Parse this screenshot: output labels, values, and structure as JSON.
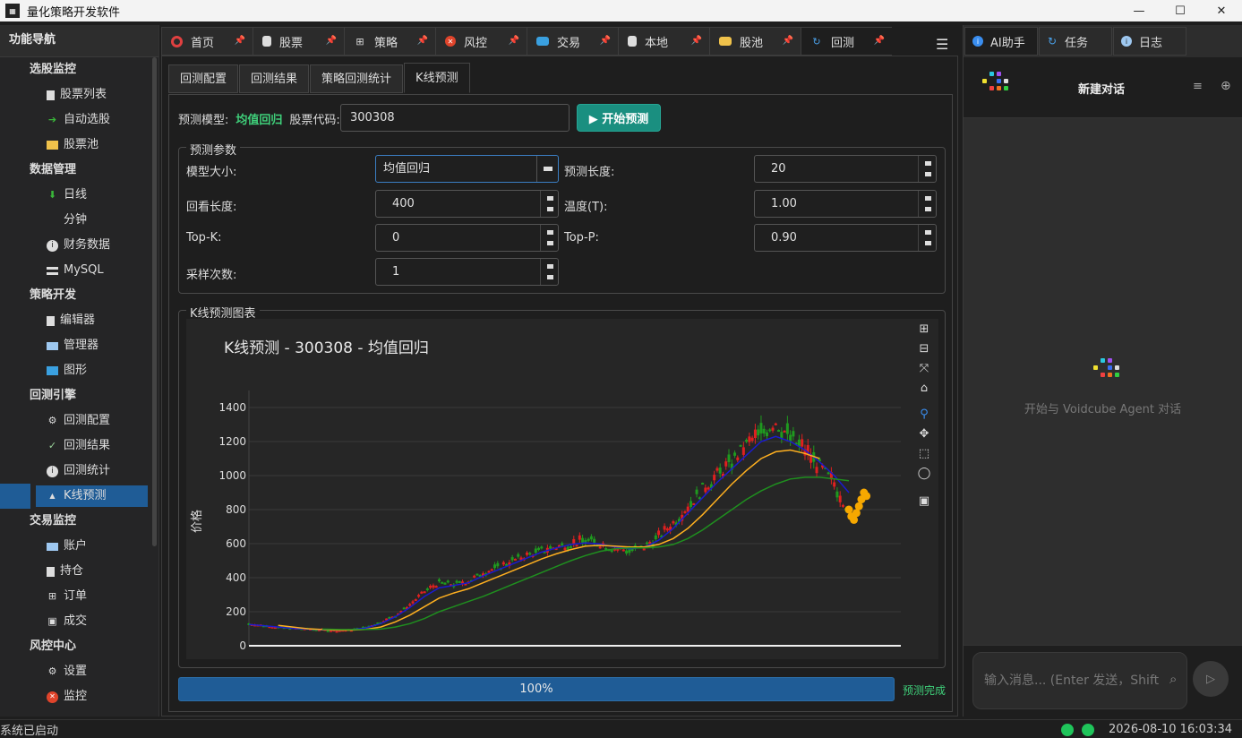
{
  "window": {
    "title": "量化策略开发软件",
    "minimize": "—",
    "maximize": "☐",
    "close": "✕"
  },
  "sidebar": {
    "header": "功能导航",
    "groups": [
      {
        "label": "选股监控",
        "items": [
          "股票列表",
          "自动选股",
          "股票池"
        ]
      },
      {
        "label": "数据管理",
        "items": [
          "日线",
          "分钟",
          "财务数据",
          "MySQL"
        ]
      },
      {
        "label": "策略开发",
        "items": [
          "编辑器",
          "管理器",
          "图形"
        ]
      },
      {
        "label": "回测引擎",
        "items": [
          "回测配置",
          "回测结果",
          "回测统计",
          "K线预测"
        ]
      },
      {
        "label": "交易监控",
        "items": [
          "账户",
          "持仓",
          "订单",
          "成交"
        ]
      },
      {
        "label": "风控中心",
        "items": [
          "设置",
          "监控"
        ]
      }
    ]
  },
  "main_tabs": [
    "首页",
    "股票",
    "策略",
    "风控",
    "交易",
    "本地",
    "股池",
    "回测"
  ],
  "sub_tabs": [
    "回测配置",
    "回测结果",
    "策略回测统计",
    "K线预测"
  ],
  "predict": {
    "model_label": "预测模型:",
    "model_value": "均值回归",
    "code_label": "股票代码:",
    "code_value": "300308",
    "start_button": "▶ 开始预测"
  },
  "params": {
    "title": "预测参数",
    "model_size_label": "模型大小:",
    "model_size_value": "均值回归",
    "pred_len_label": "预测长度:",
    "pred_len_value": "20",
    "lookback_label": "回看长度:",
    "lookback_value": "400",
    "temp_label": "温度(T):",
    "temp_value": "1.00",
    "topk_label": "Top-K:",
    "topk_value": "0",
    "topp_label": "Top-P:",
    "topp_value": "0.90",
    "samples_label": "采样次数:",
    "samples_value": "1"
  },
  "chart_section": {
    "title": "K线预测图表"
  },
  "chart_data": {
    "type": "line",
    "title": "K线预测 - 300308 - 均值回归",
    "ylabel": "价格",
    "ylim": [
      0,
      1500
    ],
    "yticks": [
      "0",
      "200",
      "400",
      "600",
      "800",
      "1000",
      "1200",
      "1400"
    ],
    "grid": true,
    "series": [
      {
        "color": "#c8b400",
        "role": "close",
        "values": [
          130,
          120,
          110,
          105,
          100,
          95,
          90,
          95,
          110,
          140,
          180,
          240,
          320,
          370,
          360,
          380,
          430,
          460,
          500,
          530,
          560,
          580,
          600,
          620,
          600,
          570,
          560,
          580,
          640,
          720,
          820,
          920,
          1000,
          1080,
          1180,
          1250,
          1320,
          1220,
          1150,
          1050,
          950,
          800
        ]
      },
      {
        "color": "#1b1bd0",
        "role": "ma-fast",
        "values": [
          125,
          118,
          110,
          102,
          98,
          94,
          92,
          94,
          105,
          130,
          170,
          225,
          290,
          340,
          355,
          370,
          410,
          445,
          480,
          515,
          550,
          575,
          595,
          605,
          598,
          580,
          570,
          578,
          620,
          690,
          780,
          870,
          960,
          1040,
          1120,
          1200,
          1230,
          1200,
          1150,
          1080,
          1000,
          900
        ]
      },
      {
        "color": "#ffb020",
        "role": "ma-mid",
        "values": [
          null,
          null,
          120,
          110,
          100,
          95,
          92,
          92,
          96,
          110,
          140,
          180,
          230,
          280,
          310,
          335,
          370,
          405,
          440,
          475,
          510,
          540,
          565,
          585,
          590,
          585,
          580,
          580,
          595,
          630,
          690,
          770,
          860,
          950,
          1030,
          1100,
          1140,
          1150,
          1130,
          1100,
          null,
          null
        ]
      },
      {
        "color": "#1f8f1f",
        "role": "ma-slow",
        "values": [
          null,
          null,
          null,
          null,
          null,
          98,
          96,
          95,
          95,
          98,
          110,
          130,
          160,
          200,
          230,
          260,
          290,
          325,
          360,
          395,
          430,
          465,
          500,
          530,
          555,
          570,
          575,
          575,
          580,
          595,
          630,
          680,
          740,
          800,
          860,
          910,
          950,
          980,
          990,
          990,
          980,
          970
        ]
      },
      {
        "color": "#f6a800",
        "role": "prediction",
        "values": [
          800,
          760,
          740,
          780,
          820,
          860,
          900,
          880
        ]
      }
    ]
  },
  "progress": {
    "value": 100,
    "label": "100%",
    "status": "预测完成"
  },
  "right_tabs": [
    "AI助手",
    "任务",
    "日志"
  ],
  "chat": {
    "title": "新建对话",
    "empty": "开始与 Voidcube Agent 对话",
    "placeholder": "输入消息... (Enter 发送，Shift"
  },
  "status": {
    "text": "系统已启动",
    "time": "2026-08-10 16:03:34"
  }
}
